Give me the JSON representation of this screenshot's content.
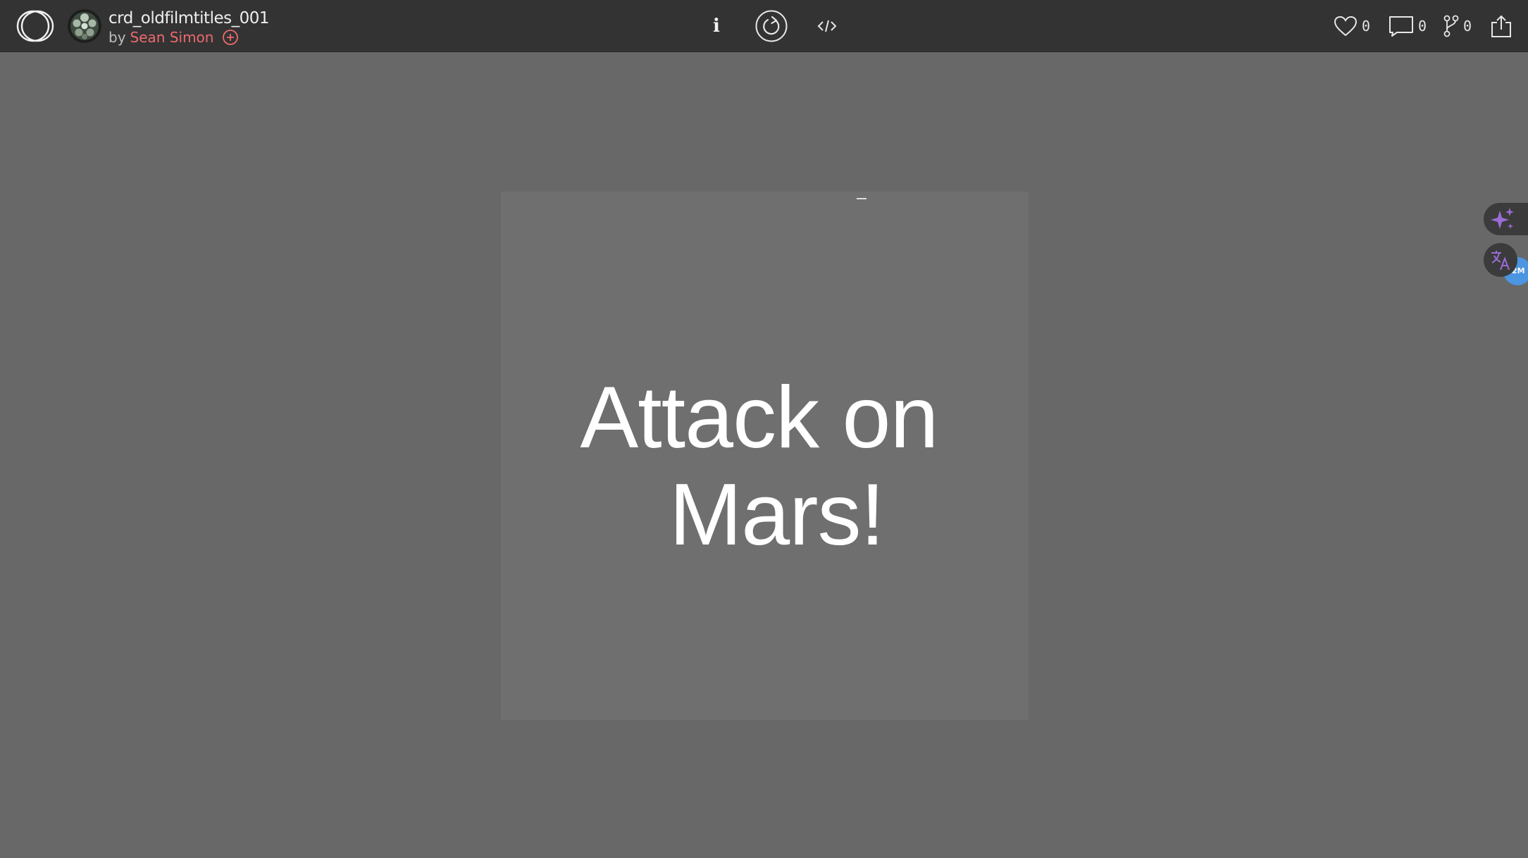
{
  "header": {
    "sketch_title": "crd_oldfilmtitles_001",
    "by_label": "by",
    "author": "Sean Simon",
    "info_label": "i",
    "likes_count": "0",
    "comments_count": "0",
    "forks_count": "0"
  },
  "canvas": {
    "title_line1": "Attack on",
    "title_line2": "Mars!"
  },
  "side_widgets": {
    "badge_text": "2M"
  },
  "icons": {
    "logo": "openprocessing-logo-icon",
    "avatar": "user-avatar",
    "follow": "plus-circle-icon",
    "info": "info-icon",
    "reload": "reload-icon",
    "code": "code-icon",
    "like": "heart-icon",
    "comment": "comment-icon",
    "fork": "fork-icon",
    "share": "share-icon",
    "ai": "sparkle-icon",
    "translate": "translate-icon"
  },
  "colors": {
    "header_bg": "#333333",
    "page_bg": "#686868",
    "canvas_bg": "#6f6f6f",
    "author": "#ec6a6d",
    "badge": "#4a98e8",
    "sparkle": "#9b6cd6"
  }
}
